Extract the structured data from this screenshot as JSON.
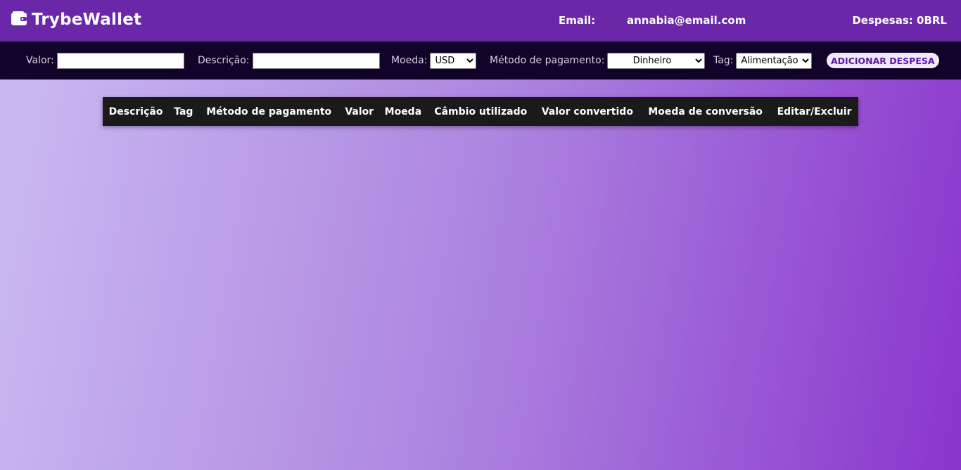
{
  "header": {
    "title": "TrybeWallet",
    "logo_icon": "wallet-icon",
    "email_label": "Email:",
    "email_value": "annabia@email.com",
    "expenses_text": "Despesas: 0BRL"
  },
  "form": {
    "valor_label": "Valor:",
    "valor_value": "",
    "descricao_label": "Descrição:",
    "descricao_value": "",
    "moeda_label": "Moeda:",
    "moeda_selected": "USD",
    "metodo_label": "Método de pagamento:",
    "metodo_selected": "Dinheiro",
    "tag_label": "Tag:",
    "tag_selected": "Alimentação",
    "add_button": "ADICIONAR DESPESA"
  },
  "table": {
    "headers": [
      "Descrição",
      "Tag",
      "Método de pagamento",
      "Valor",
      "Moeda",
      "Câmbio utilizado",
      "Valor convertido",
      "Moeda de conversão",
      "Editar/Excluir"
    ]
  },
  "colors": {
    "header_bg": "#6a28a8",
    "form_bg": "#12032b",
    "table_bg": "#1a1a1a",
    "button_text": "#5a1aa0"
  }
}
